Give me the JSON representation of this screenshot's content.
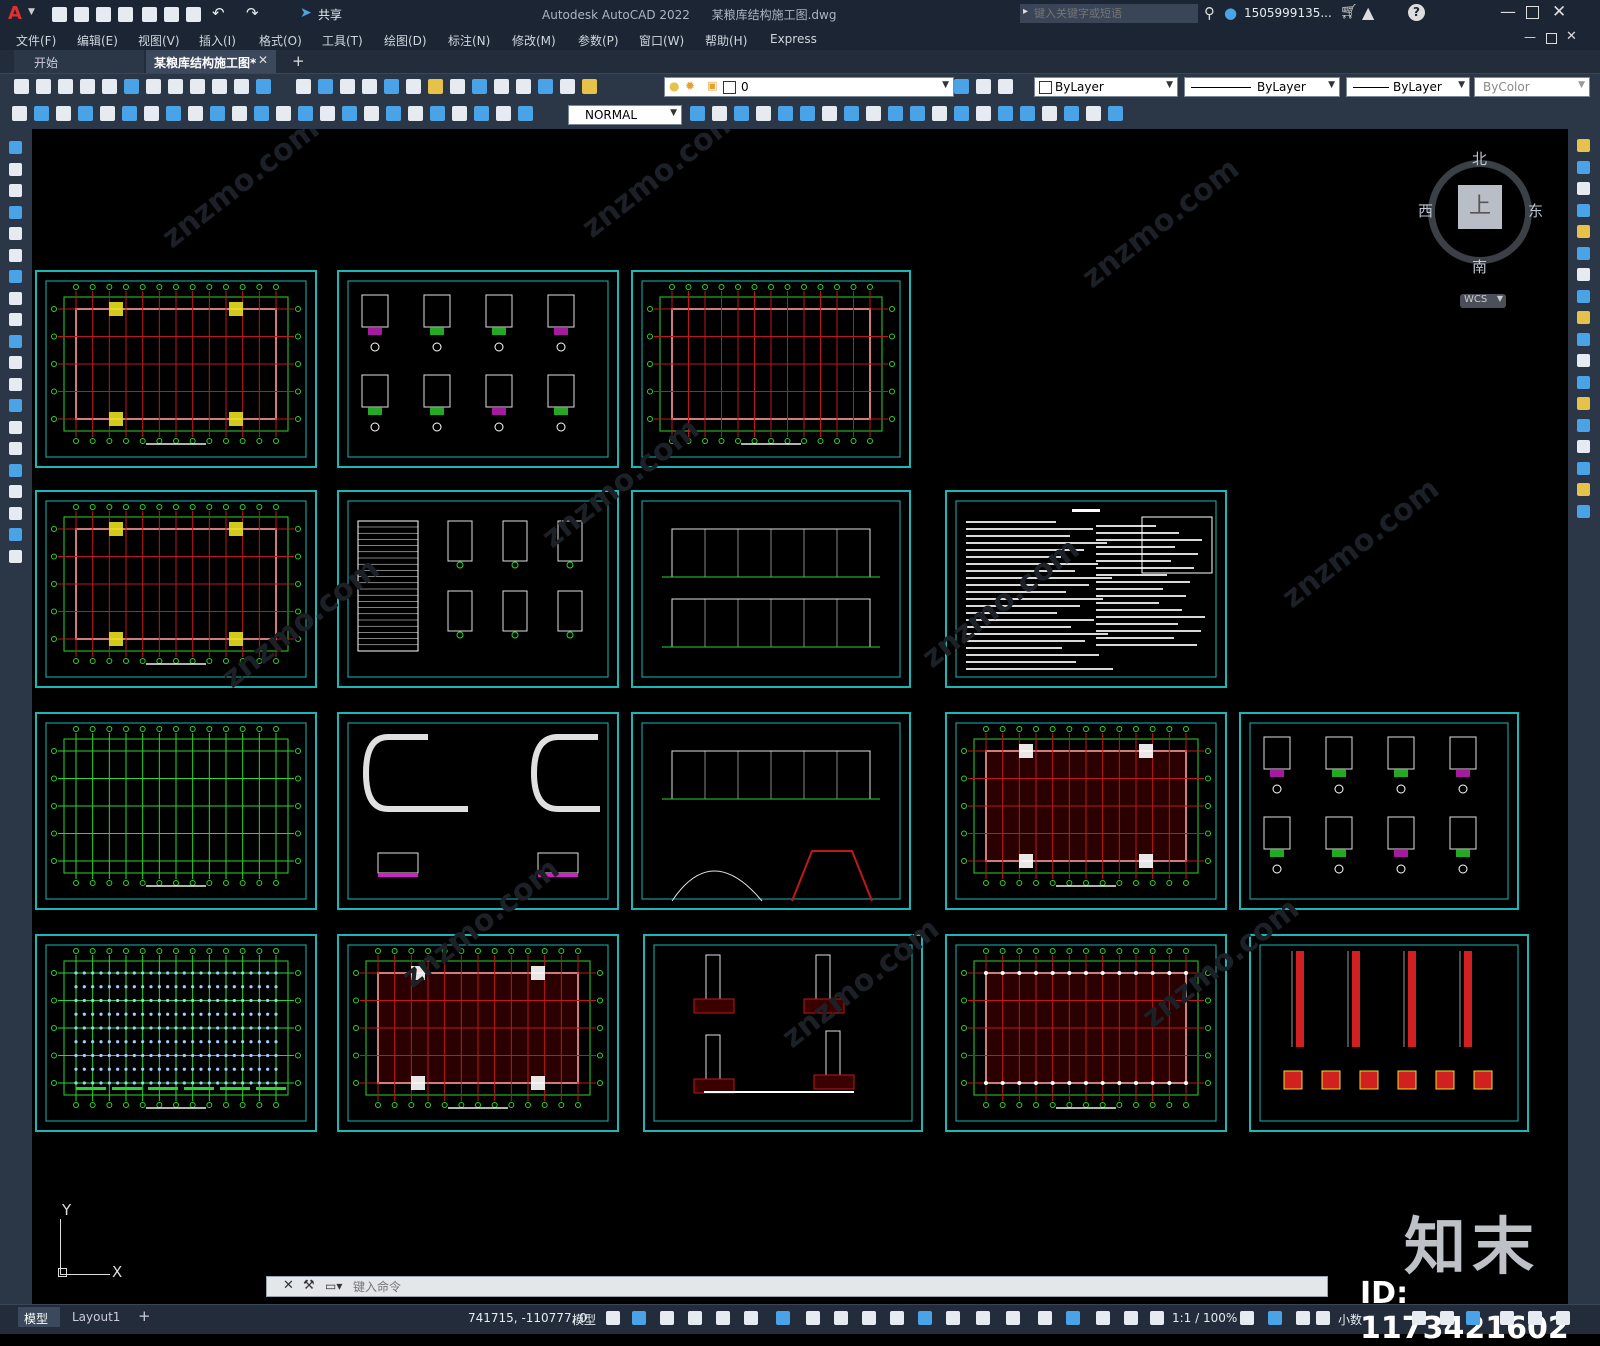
{
  "app": {
    "logo": "A",
    "title": "Autodesk AutoCAD 2022",
    "filename": "某粮库结构施工图.dwg",
    "share_label": "共享",
    "search_placeholder": "键入关键字或短语",
    "user": "1505999135...",
    "help_icon": "question-icon"
  },
  "menu": {
    "items": [
      "文件(F)",
      "编辑(E)",
      "视图(V)",
      "插入(I)",
      "格式(O)",
      "工具(T)",
      "绘图(D)",
      "标注(N)",
      "修改(M)",
      "参数(P)",
      "窗口(W)",
      "帮助(H)",
      "Express"
    ]
  },
  "tabs": {
    "start": "开始",
    "active": "某粮库结构施工图*",
    "add": "+"
  },
  "properties": {
    "layer": "0",
    "color": "ByLayer",
    "linetype": "ByLayer",
    "lineweight": "ByLayer",
    "plotstyle": "ByColor",
    "dimstyle": "NORMAL"
  },
  "viewcube": {
    "north": "北",
    "south": "南",
    "east": "东",
    "west": "西",
    "top": "上",
    "wcs": "WCS"
  },
  "ucs": {
    "x": "X",
    "y": "Y"
  },
  "command": {
    "placeholder": "键入命令"
  },
  "layout_tabs": {
    "model": "模型",
    "layout1": "Layout1",
    "add": "+"
  },
  "status": {
    "coords": "741715, -110777, 0",
    "model": "模型",
    "scale": "1:1 / 100%",
    "units": "小数"
  },
  "overlay": {
    "brand": "知末",
    "id": "ID: 1173421602",
    "watermark": "znzmo.com"
  },
  "colors": {
    "frame": "#19b7b7",
    "grid": "#2bd62b",
    "fill": "#c01818",
    "accent_yellow": "#e8e020",
    "magenta": "#d020c8"
  }
}
